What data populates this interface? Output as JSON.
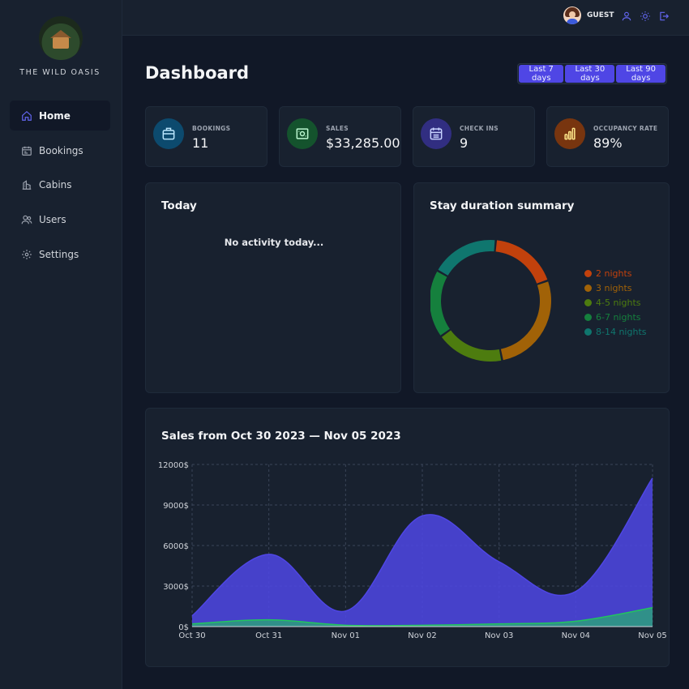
{
  "brand": {
    "name": "THE WILD OASIS"
  },
  "sidebar": {
    "items": [
      {
        "label": "Home",
        "icon": "home-icon",
        "active": true
      },
      {
        "label": "Bookings",
        "icon": "calendar-icon",
        "active": false
      },
      {
        "label": "Cabins",
        "icon": "building-icon",
        "active": false
      },
      {
        "label": "Users",
        "icon": "users-icon",
        "active": false
      },
      {
        "label": "Settings",
        "icon": "gear-icon",
        "active": false
      }
    ]
  },
  "header": {
    "user_name": "GUEST",
    "icons": [
      "user-icon",
      "sun-icon",
      "logout-icon"
    ]
  },
  "main": {
    "title": "Dashboard",
    "filters": [
      "Last 7 days",
      "Last 30 days",
      "Last 90 days"
    ],
    "stats": [
      {
        "label": "BOOKINGS",
        "value": "11",
        "icon": "briefcase-icon",
        "color": "#1d6fa3"
      },
      {
        "label": "SALES",
        "value": "$33,285.00",
        "icon": "banknotes-icon",
        "color": "#15803d"
      },
      {
        "label": "CHECK INS",
        "value": "9",
        "icon": "calendar-days-icon",
        "color": "#3730a3"
      },
      {
        "label": "OCCUPANCY RATE",
        "value": "89%",
        "icon": "bar-chart-icon",
        "color": "#a15c0a"
      }
    ],
    "today": {
      "title": "Today",
      "empty_text": "No activity today..."
    },
    "stay": {
      "title": "Stay duration summary"
    },
    "sales": {
      "title": "Sales from Oct 30 2023 — Nov 05 2023"
    }
  },
  "chart_data": [
    {
      "type": "pie",
      "variant": "donut",
      "categories": [
        "2 nights",
        "3 nights",
        "4-5 nights",
        "6-7 nights",
        "8-14 nights"
      ],
      "values": [
        2,
        3,
        2,
        2,
        2
      ],
      "colors": [
        "#c2410c",
        "#a16207",
        "#4d7c0f",
        "#15803d",
        "#0f766e"
      ],
      "legend": "right"
    },
    {
      "type": "area",
      "categories": [
        "Oct 30",
        "Oct 31",
        "Nov 01",
        "Nov 02",
        "Nov 03",
        "Nov 04",
        "Nov 05"
      ],
      "series": [
        {
          "values": [
            800,
            5350,
            1150,
            8200,
            4800,
            2600,
            11000
          ],
          "color": "#4f46e5"
        },
        {
          "values": [
            200,
            500,
            100,
            100,
            200,
            400,
            1400
          ],
          "color": "#22c55e"
        }
      ],
      "ylim": [
        0,
        12000
      ],
      "yticks": [
        "0$",
        "3000$",
        "6000$",
        "9000$",
        "12000$"
      ],
      "grid": true,
      "legend": "none"
    }
  ]
}
